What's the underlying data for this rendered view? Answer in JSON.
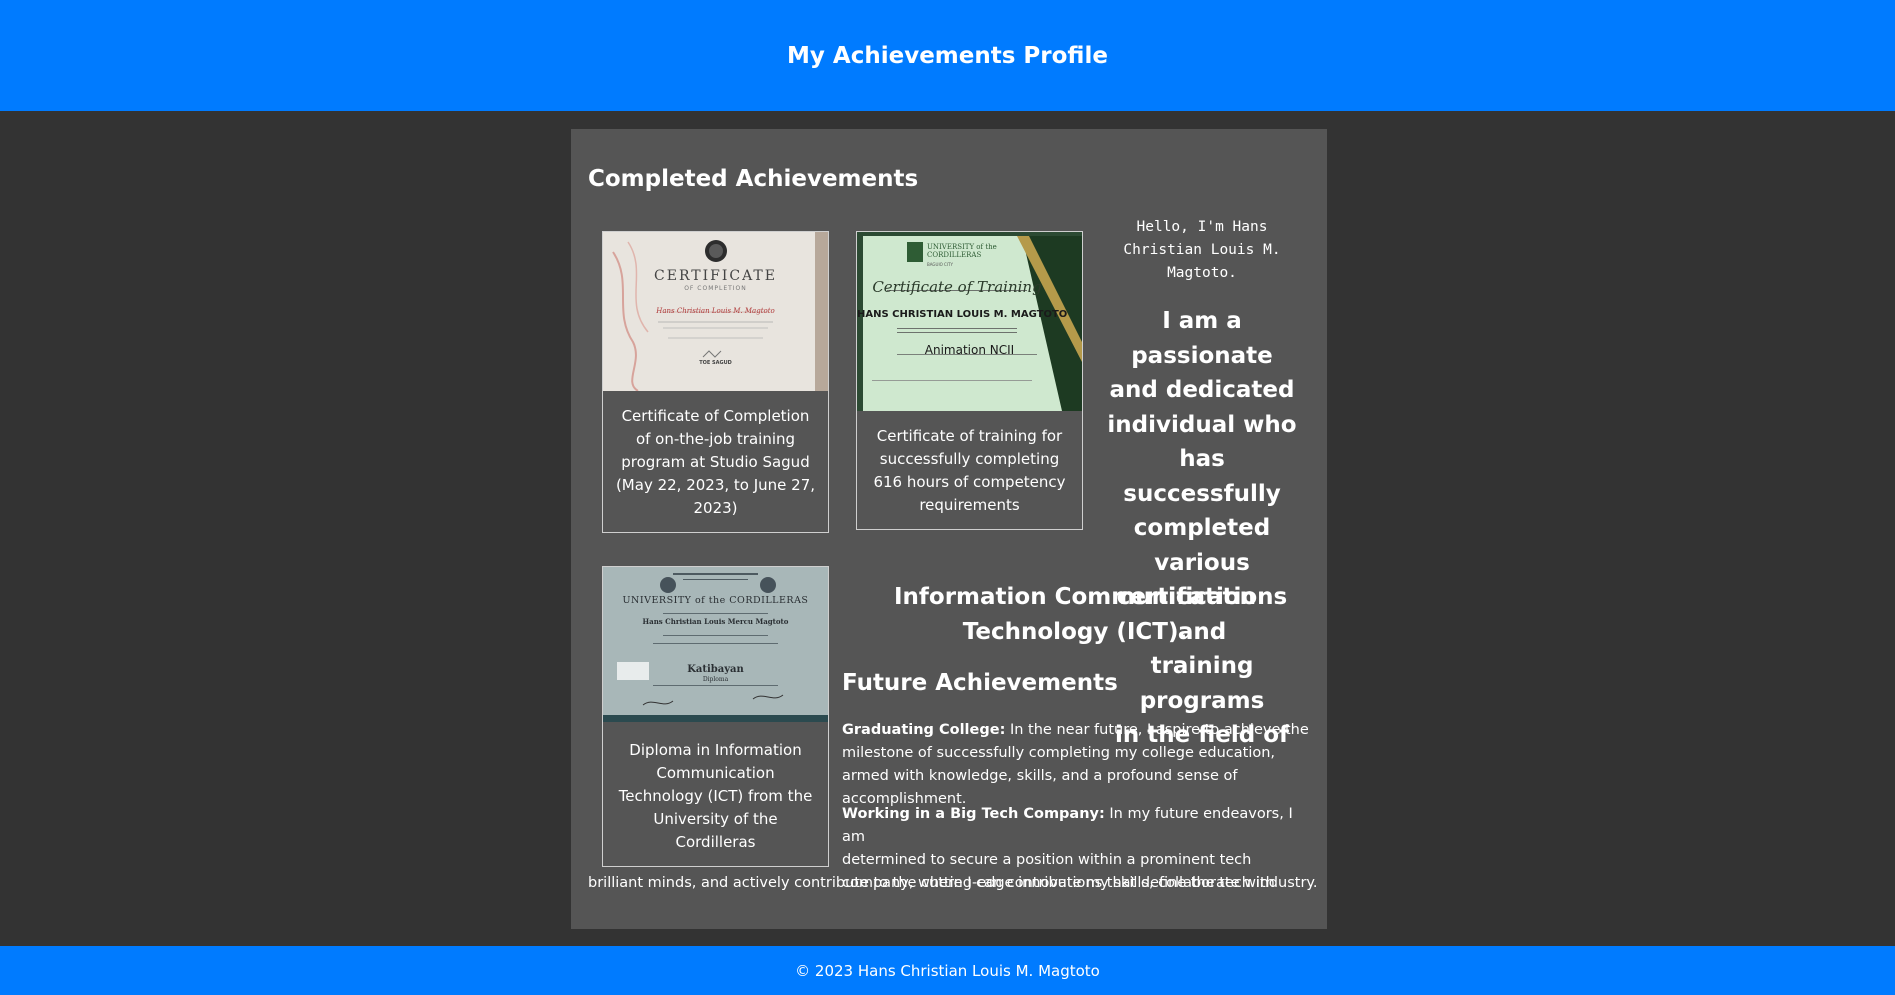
{
  "header": {
    "title": "My Achievements Profile"
  },
  "completed": {
    "title": "Completed Achievements",
    "certificates": [
      {
        "image_lines": [
          "CERTIFICATE",
          "OF COMPLETION",
          "Hans Christian Louis M. Magtoto",
          "TOE SAGUD"
        ],
        "caption": "Certificate of Completion of on-the-job training program at Studio Sagud (May 22, 2023, to June 27, 2023)"
      },
      {
        "image_lines": [
          "UNIVERSITY of the CORDILLERAS",
          "BAGUIO CITY",
          "Certificate of Training",
          "HANS CHRISTIAN LOUIS M. MAGTOTO",
          "Animation NCII"
        ],
        "caption": "Certificate of training for successfully completing 616 hours of competency requirements"
      },
      {
        "image_lines": [
          "UNIVERSITY of the CORDILLERAS",
          "Hans Christian Louis Mercu Magtoto",
          "Katibayan",
          "Diploma"
        ],
        "caption": "Diploma in Information Communication Technology (ICT) from the University of the Cordilleras"
      }
    ]
  },
  "intro": {
    "greeting": "Hello, I'm Hans Christian Louis M. Magtoto.",
    "statement_lines": [
      "I am a passionate",
      "and dedicated",
      "individual who has",
      "successfully",
      "completed various",
      "certifications and",
      "training programs",
      "in the field of"
    ],
    "statement_tail": "Information Communication Technology (ICT)."
  },
  "future": {
    "title": "Future Achievements",
    "items": [
      {
        "label": "Graduating College:",
        "text": " In the near future, I aspire to achieve the milestone of successfully completing my college education, armed with knowledge, skills, and a profound sense of accomplishment."
      },
      {
        "label": "Working in a Big Tech Company:",
        "text_lines": [
          " In my future endeavors, I am",
          "determined to secure a position within a prominent tech",
          "company, where I can contribute my skills, collaborate with",
          "brilliant minds, and actively contribute to the cutting-edge innovations that define the tech industry."
        ]
      }
    ]
  },
  "footer": {
    "text": "© 2023 Hans Christian Louis M. Magtoto"
  }
}
